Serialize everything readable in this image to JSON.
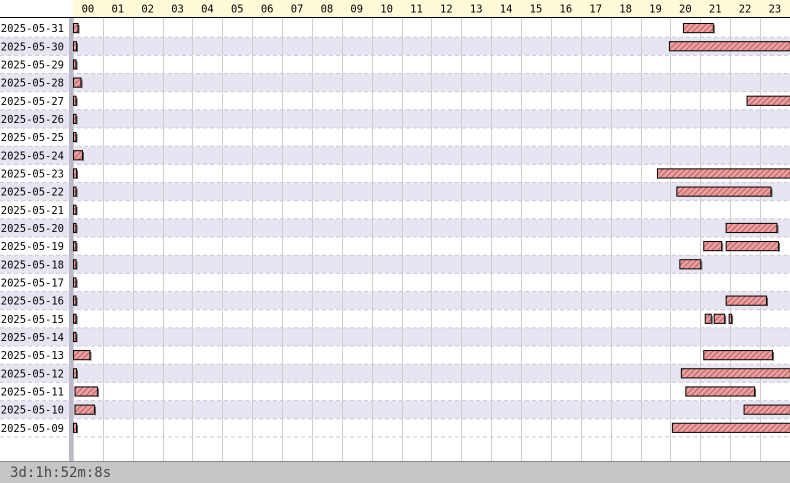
{
  "chart_data": {
    "type": "gantt",
    "hours": [
      "00",
      "01",
      "02",
      "03",
      "04",
      "05",
      "06",
      "07",
      "08",
      "09",
      "10",
      "11",
      "12",
      "13",
      "14",
      "15",
      "16",
      "17",
      "18",
      "19",
      "20",
      "21",
      "22",
      "23"
    ],
    "rows": [
      {
        "date": "2025-05-31",
        "segments": [
          [
            0.0,
            0.15
          ],
          [
            20.42,
            21.42
          ]
        ]
      },
      {
        "date": "2025-05-30",
        "segments": [
          [
            0.0,
            0.1
          ],
          [
            19.95,
            24.0
          ]
        ]
      },
      {
        "date": "2025-05-29",
        "segments": [
          [
            0.0,
            0.08
          ]
        ]
      },
      {
        "date": "2025-05-28",
        "segments": [
          [
            0.0,
            0.25
          ]
        ]
      },
      {
        "date": "2025-05-27",
        "segments": [
          [
            0.0,
            0.08
          ],
          [
            22.55,
            24.0
          ]
        ]
      },
      {
        "date": "2025-05-26",
        "segments": [
          [
            0.0,
            0.08
          ]
        ]
      },
      {
        "date": "2025-05-25",
        "segments": [
          [
            0.0,
            0.08
          ]
        ]
      },
      {
        "date": "2025-05-24",
        "segments": [
          [
            0.0,
            0.3
          ]
        ]
      },
      {
        "date": "2025-05-23",
        "segments": [
          [
            0.0,
            0.1
          ],
          [
            19.55,
            24.0
          ]
        ]
      },
      {
        "date": "2025-05-22",
        "segments": [
          [
            0.0,
            0.08
          ],
          [
            20.2,
            23.35
          ]
        ]
      },
      {
        "date": "2025-05-21",
        "segments": [
          [
            0.0,
            0.08
          ]
        ]
      },
      {
        "date": "2025-05-20",
        "segments": [
          [
            0.0,
            0.08
          ],
          [
            21.85,
            23.55
          ]
        ]
      },
      {
        "date": "2025-05-19",
        "segments": [
          [
            0.0,
            0.08
          ],
          [
            21.1,
            21.7
          ],
          [
            21.85,
            23.6
          ]
        ]
      },
      {
        "date": "2025-05-18",
        "segments": [
          [
            0.0,
            0.08
          ],
          [
            20.3,
            21.0
          ]
        ]
      },
      {
        "date": "2025-05-17",
        "segments": [
          [
            0.0,
            0.08
          ]
        ]
      },
      {
        "date": "2025-05-16",
        "segments": [
          [
            0.0,
            0.08
          ],
          [
            21.85,
            23.2
          ]
        ]
      },
      {
        "date": "2025-05-15",
        "segments": [
          [
            0.0,
            0.08
          ],
          [
            21.15,
            21.35
          ],
          [
            21.45,
            21.8
          ],
          [
            21.95,
            22.03
          ]
        ]
      },
      {
        "date": "2025-05-14",
        "segments": [
          [
            0.0,
            0.08
          ]
        ]
      },
      {
        "date": "2025-05-13",
        "segments": [
          [
            0.0,
            0.55
          ],
          [
            21.1,
            23.4
          ]
        ]
      },
      {
        "date": "2025-05-12",
        "segments": [
          [
            0.0,
            0.1
          ],
          [
            20.35,
            24.0
          ]
        ]
      },
      {
        "date": "2025-05-11",
        "segments": [
          [
            0.05,
            0.8
          ],
          [
            20.5,
            22.8
          ]
        ]
      },
      {
        "date": "2025-05-10",
        "segments": [
          [
            0.05,
            0.7
          ],
          [
            22.45,
            24.0
          ]
        ]
      },
      {
        "date": "2025-05-09",
        "segments": [
          [
            0.0,
            0.1
          ],
          [
            20.05,
            24.0
          ]
        ]
      }
    ],
    "total_label": "3d:1h:52m:8s",
    "colors": {
      "bar_fill": "#e8a0a0",
      "bar_hatch": "#b94a4a",
      "bar_border": "#000000",
      "row_alt": "#e6e6f2",
      "header_bg": "#fffbd9",
      "footer_bg": "#c6c6c6"
    }
  }
}
